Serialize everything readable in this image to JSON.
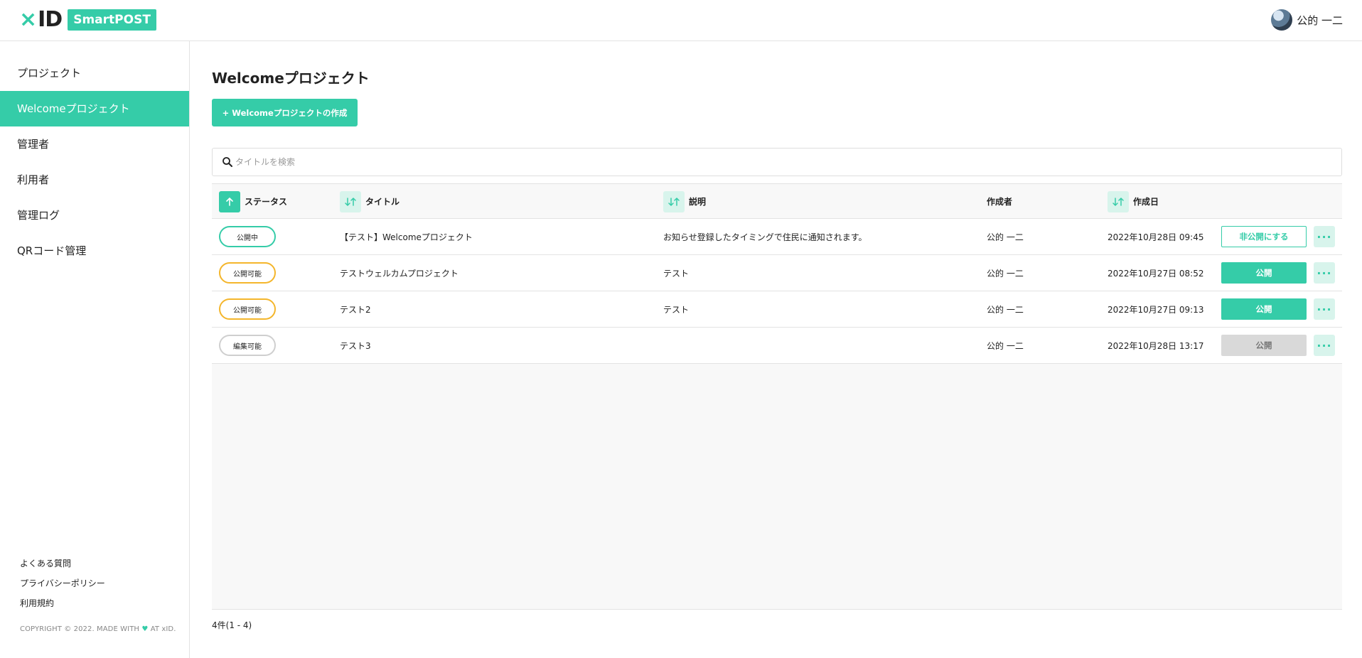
{
  "header": {
    "logo_x": "×",
    "logo_id": "ID",
    "logo_badge": "SmartPOST",
    "user_name": "公的 一二"
  },
  "sidebar": {
    "items": [
      {
        "label": "プロジェクト"
      },
      {
        "label": "Welcomeプロジェクト",
        "active": true
      },
      {
        "label": "管理者"
      },
      {
        "label": "利用者"
      },
      {
        "label": "管理ログ"
      },
      {
        "label": "QRコード管理"
      }
    ],
    "footer_links": [
      "よくある質問",
      "プライバシーポリシー",
      "利用規約"
    ],
    "copyright_prefix": "COPYRIGHT © 2022. MADE WITH",
    "copyright_heart": "♥",
    "copyright_suffix": "AT xID."
  },
  "main": {
    "title": "Welcomeプロジェクト",
    "create_button": "+ Welcomeプロジェクトの作成",
    "search_placeholder": "タイトルを検索",
    "columns": {
      "status": "ステータス",
      "title": "タイトル",
      "description": "説明",
      "author": "作成者",
      "created": "作成日"
    },
    "rows": [
      {
        "status": "公開中",
        "title": "【テスト】Welcomeプロジェクト",
        "description": "お知らせ登録したタイミングで住民に通知されます。",
        "author": "公的 一二",
        "created": "2022年10月28日 09:45",
        "action": "非公開にする"
      },
      {
        "status": "公開可能",
        "title": "テストウェルカムプロジェクト",
        "description": "テスト",
        "author": "公的 一二",
        "created": "2022年10月27日 08:52",
        "action": "公開"
      },
      {
        "status": "公開可能",
        "title": "テスト2",
        "description": "テスト",
        "author": "公的 一二",
        "created": "2022年10月27日 09:13",
        "action": "公開"
      },
      {
        "status": "編集可能",
        "title": "テスト3",
        "description": "",
        "author": "公的 一二",
        "created": "2022年10月28日 13:17",
        "action": "公開"
      }
    ],
    "more_label": "···",
    "count": "4件(1 - 4)"
  },
  "colors": {
    "accent": "#35cca8",
    "accent_light": "#d8f4ec",
    "warning": "#f4b62c",
    "disabled": "#d9d9d9",
    "border": "#e3e3e3"
  },
  "icons": {
    "sort_asc": "arrow-up-icon",
    "sort_both": "sort-arrows-icon",
    "search": "search-icon",
    "more": "ellipsis-icon",
    "heart": "heart-icon"
  }
}
